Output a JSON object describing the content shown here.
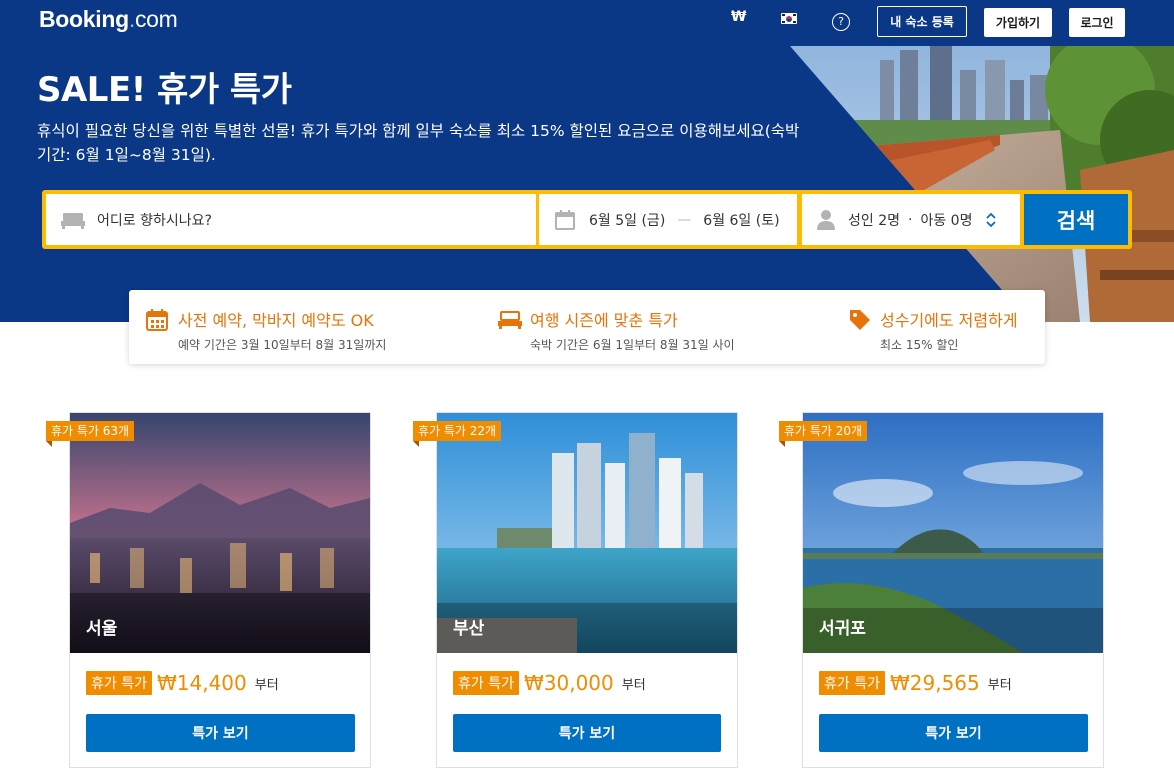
{
  "header": {
    "logo_brand": "Booking",
    "logo_dot": ".",
    "logo_com": "com",
    "currency": "₩",
    "help": "?",
    "list_property": "내 숙소 등록",
    "register": "가입하기",
    "sign_in": "로그인"
  },
  "hero": {
    "title": "SALE! 휴가 특가",
    "subtitle": "휴식이 필요한 당신을 위한 특별한 선물! 휴가 특가와 함께 일부 숙소를 최소 15% 할인된 요금으로 이용해보세요(숙박 기간: 6월 1일~8월 31일)."
  },
  "search": {
    "destination_placeholder": "어디로 향하시나요?",
    "checkin": "6월 5일 (금)",
    "date_sep": "—",
    "checkout": "6월 6일 (토)",
    "adults": "성인 2명",
    "guest_sep": "·",
    "children": "아동 0명",
    "button": "검색"
  },
  "features": [
    {
      "icon": "calendar-icon",
      "title": "사전 예약, 막바지 예약도 OK",
      "sub": "예약 기간은 3월 10일부터 8월 31일까지"
    },
    {
      "icon": "bed-icon",
      "title": "여행 시즌에 맞춘 특가",
      "sub": "숙박 기간은 6월 1일부터 8월 31일 사이"
    },
    {
      "icon": "tag-icon",
      "title": "성수기에도 저렴하게",
      "sub": "최소 15% 할인"
    }
  ],
  "cards": [
    {
      "ribbon": "휴가 특가 63개",
      "city": "서울",
      "badge": "휴가 특가",
      "price": "₩14,400",
      "from": "부터",
      "button": "특가 보기"
    },
    {
      "ribbon": "휴가 특가 22개",
      "city": "부산",
      "badge": "휴가 특가",
      "price": "₩30,000",
      "from": "부터",
      "button": "특가 보기"
    },
    {
      "ribbon": "휴가 특가 20개",
      "city": "서귀포",
      "badge": "휴가 특가",
      "price": "₩29,565",
      "from": "부터",
      "button": "특가 보기"
    }
  ],
  "colors": {
    "brand_navy": "#0b3787",
    "search_yellow": "#febb02",
    "button_blue": "#0071c2",
    "deal_orange": "#f08c00"
  }
}
